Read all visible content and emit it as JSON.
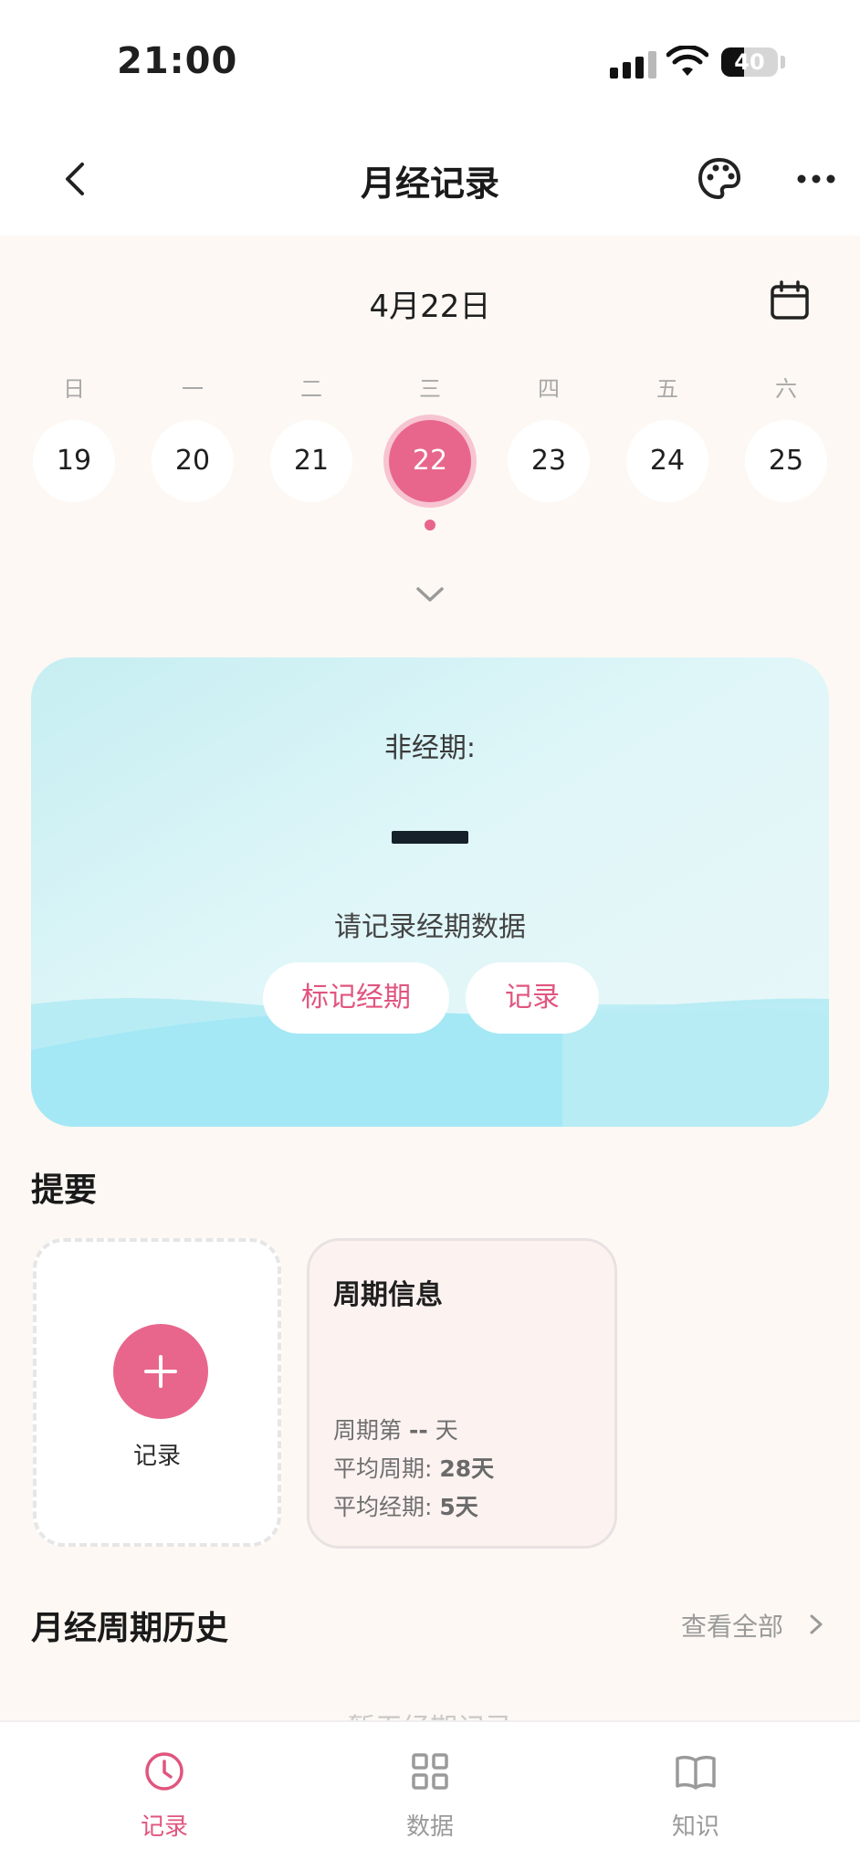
{
  "status_bar": {
    "time": "21:00",
    "battery": "40",
    "battery_level": 0.4
  },
  "nav": {
    "title": "月经记录"
  },
  "date_header": {
    "label": "4月22日"
  },
  "week": {
    "weekdays": [
      "日",
      "一",
      "二",
      "三",
      "四",
      "五",
      "六"
    ],
    "dates": [
      "19",
      "20",
      "21",
      "22",
      "23",
      "24",
      "25"
    ],
    "selected": "22"
  },
  "hero": {
    "label": "非经期:",
    "prompt": "请记录经期数据",
    "mark_button": "标记经期",
    "record_button": "记录"
  },
  "summary": {
    "title": "提要",
    "add_label": "记录",
    "cycle_card": {
      "title": "周期信息",
      "day_prefix": "周期第",
      "day_value": "--",
      "day_suffix": "天",
      "avg_cycle_label": "平均周期:",
      "avg_cycle_value": "28天",
      "avg_period_label": "平均经期:",
      "avg_period_value": "5天"
    }
  },
  "history": {
    "title": "月经周期历史",
    "view_all": "查看全部",
    "empty": "暂无经期记录"
  },
  "tabs": [
    {
      "label": "记录",
      "icon": "clock-icon",
      "active": true
    },
    {
      "label": "数据",
      "icon": "grid-icon",
      "active": false
    },
    {
      "label": "知识",
      "icon": "book-icon",
      "active": false
    }
  ],
  "colors": {
    "accent": "#e8668c",
    "accent_text": "#e0557e",
    "background": "#fdf8f3"
  }
}
